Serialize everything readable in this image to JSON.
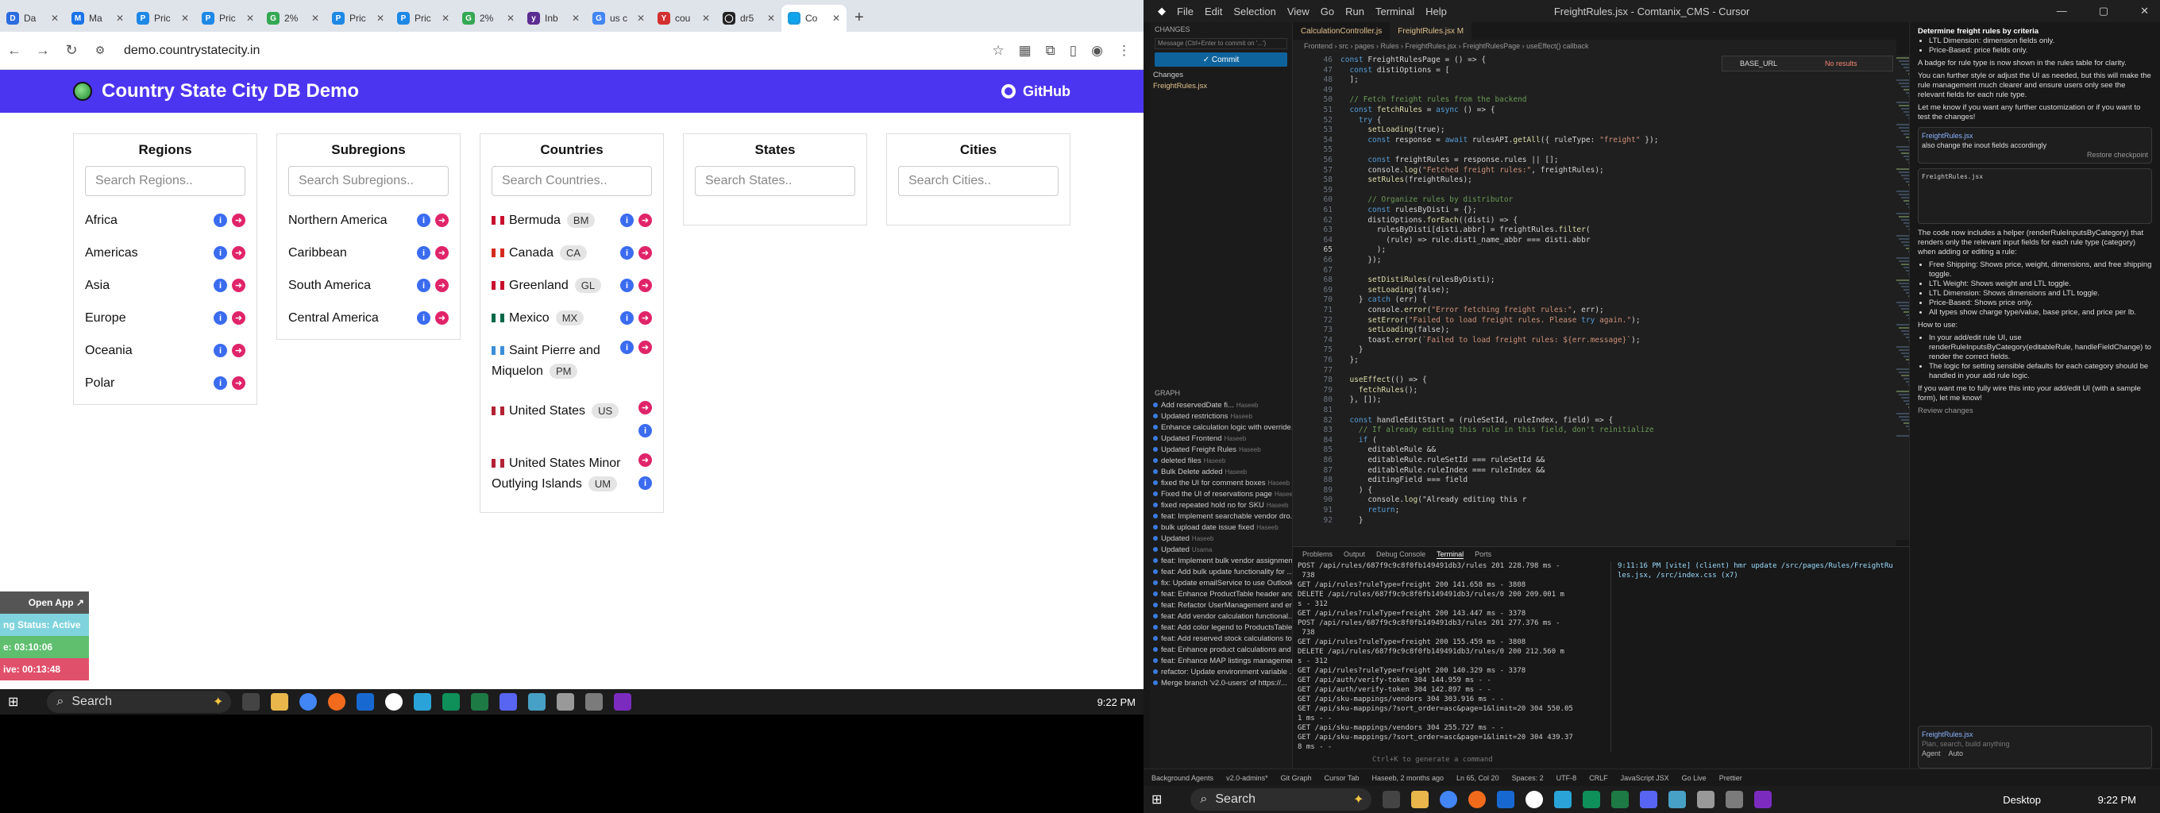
{
  "browser": {
    "tabs": [
      {
        "label": "Da",
        "color": "#2b6cdf",
        "glyph": "D"
      },
      {
        "label": "Ma",
        "color": "#1a73e8",
        "glyph": "M"
      },
      {
        "label": "Pric",
        "color": "#1e88e5",
        "glyph": "P"
      },
      {
        "label": "Pric",
        "color": "#1e88e5",
        "glyph": "P"
      },
      {
        "label": "2%",
        "color": "#34a853",
        "glyph": "G"
      },
      {
        "label": "Pric",
        "color": "#1e88e5",
        "glyph": "P"
      },
      {
        "label": "Pric",
        "color": "#1e88e5",
        "glyph": "P"
      },
      {
        "label": "2%",
        "color": "#34a853",
        "glyph": "G"
      },
      {
        "label": "Inb",
        "color": "#5b2d90",
        "glyph": "y"
      },
      {
        "label": "us c",
        "color": "#4285f4",
        "glyph": "G"
      },
      {
        "label": "cou",
        "color": "#d32f2f",
        "glyph": "Y"
      },
      {
        "label": "dr5",
        "color": "#222222",
        "glyph": "◯"
      },
      {
        "label": "Co",
        "color": "#1a9be0",
        "glyph": "🌐"
      }
    ],
    "url": "demo.countrystatecity.in"
  },
  "site": {
    "title": "Country State City DB Demo",
    "github": "GitHub",
    "colors": {
      "header": "#4c35f0",
      "info": "#3b6cf0",
      "action": "#e0246a"
    },
    "regions": {
      "title": "Regions",
      "placeholder": "Search Regions..",
      "items": [
        "Africa",
        "Americas",
        "Asia",
        "Europe",
        "Oceania",
        "Polar"
      ]
    },
    "subregions": {
      "title": "Subregions",
      "placeholder": "Search Subregions..",
      "items": [
        "Northern America",
        "Caribbean",
        "South America",
        "Central America"
      ]
    },
    "countries": {
      "title": "Countries",
      "placeholder": "Search Countries..",
      "items": [
        {
          "name": "Bermuda",
          "code": "BM"
        },
        {
          "name": "Canada",
          "code": "CA"
        },
        {
          "name": "Greenland",
          "code": "GL"
        },
        {
          "name": "Mexico",
          "code": "MX"
        },
        {
          "name": "Saint Pierre and Miquelon",
          "code": "PM"
        },
        {
          "name": "United States",
          "code": "US"
        },
        {
          "name": "United States Minor Outlying Islands",
          "code": "UM"
        }
      ]
    },
    "states": {
      "title": "States",
      "placeholder": "Search States.."
    },
    "cities": {
      "title": "Cities",
      "placeholder": "Search Cities.."
    }
  },
  "overlay": {
    "open_app": "Open App ↗",
    "status": "ng Status: Active",
    "timer1": "e: 03:10:06",
    "timer2": "ive: 00:13:48"
  },
  "left_taskbar": {
    "search": "Search",
    "clock": "9:22 PM"
  },
  "editor": {
    "title": "FreightRules.jsx - Comtanix_CMS - Cursor",
    "menu": [
      "File",
      "Edit",
      "Selection",
      "View",
      "Go",
      "Run",
      "Terminal",
      "Help"
    ],
    "tabs": [
      "CalculationController.js",
      "FreightRules.jsx M"
    ],
    "breadcrumb": "Frontend › src › pages › Rules › FreightRules.jsx › FreightRulesPage › useEffect() callback",
    "find": "BASE_URL",
    "find_result": "No results",
    "commit": "✓ Commit",
    "commit_placeholder": "Message (Ctrl+Enter to commit on '...')",
    "changes_label": "Changes",
    "changed_file": "FreightRules.jsx",
    "graph_label": "GRAPH",
    "git_log": [
      [
        "Add reservedDate fi...",
        "Haseeb"
      ],
      [
        "Updated restrictions",
        "Haseeb"
      ],
      [
        "Enhance calculation logic with override...",
        ""
      ],
      [
        "Updated Frontend",
        "Haseeb"
      ],
      [
        "Updated Freight Rules",
        "Haseeb"
      ],
      [
        "deleted files",
        "Haseeb"
      ],
      [
        "Bulk Delete added",
        "Haseeb"
      ],
      [
        "fixed the UI for comment boxes",
        "Haseeb"
      ],
      [
        "Fixed the UI of reservations page",
        "Haseeb"
      ],
      [
        "fixed repeated hold no for SKU",
        "Haseeb"
      ],
      [
        "feat: Implement searchable vendor dro...",
        ""
      ],
      [
        "bulk upload date issue fixed",
        "Haseeb"
      ],
      [
        "Updated",
        "Haseeb"
      ],
      [
        "Updated",
        "Usama"
      ],
      [
        "feat: Implement bulk vendor assignmen...",
        ""
      ],
      [
        "feat: Add bulk update functionality for ...",
        ""
      ],
      [
        "fix: Update emailService to use Outlook...",
        ""
      ],
      [
        "feat: Enhance ProductTable header and...",
        ""
      ],
      [
        "feat: Refactor UserManagement and en...",
        ""
      ],
      [
        "feat: Add vendor calculation functional...",
        ""
      ],
      [
        "feat: Add color legend to ProductsTable...",
        ""
      ],
      [
        "feat: Add reserved stock calculations to...",
        ""
      ],
      [
        "feat: Enhance product calculations and ...",
        ""
      ],
      [
        "feat: Enhance MAP listings managemen...",
        ""
      ],
      [
        "refactor: Update environment variable ...",
        ""
      ],
      [
        "Merge branch 'v2.0-users' of https://...",
        ""
      ]
    ],
    "code_start": 46,
    "code": [
      "const FreightRulesPage = () => {",
      "  const distiOptions = [",
      "  ];",
      "",
      "  // Fetch freight rules from the backend",
      "  const fetchRules = async () => {",
      "    try {",
      "      setLoading(true);",
      "      const response = await rulesAPI.getAll({ ruleType: \"freight\" });",
      "",
      "      const freightRules = response.rules || [];",
      "      console.log(\"Fetched freight rules:\", freightRules);",
      "      setRules(freightRules);",
      "",
      "      // Organize rules by distributor",
      "      const rulesByDisti = {};",
      "      distiOptions.forEach((disti) => {",
      "        rulesByDisti[disti.abbr] = freightRules.filter(",
      "          (rule) => rule.disti_name_abbr === disti.abbr",
      "        );",
      "      });",
      "",
      "      setDistiRules(rulesByDisti);",
      "      setLoading(false);",
      "    } catch (err) {",
      "      console.error(\"Error fetching freight rules:\", err);",
      "      setError(\"Failed to load freight rules. Please try again.\");",
      "      setLoading(false);",
      "      toast.error(`Failed to load freight rules: ${err.message}`);",
      "    }",
      "  };",
      "",
      "  useEffect(() => {",
      "    fetchRules();",
      "  }, []);",
      "",
      "  const handleEditStart = (ruleSetId, ruleIndex, field) => {",
      "    // If already editing this rule in this field, don't reinitialize",
      "    if (",
      "      editableRule &&",
      "      editableRule.ruleSetId === ruleSetId &&",
      "      editableRule.ruleIndex === ruleIndex &&",
      "      editingField === field",
      "    ) {",
      "      console.log(\"Already editing this r",
      "      return;",
      "    }"
    ],
    "term_tabs": [
      "Problems",
      "Output",
      "Debug Console",
      "Terminal",
      "Ports"
    ],
    "term_left": [
      "POST /api/rules/687f9c9c8f0fb149491db3/rules 201 228.798 ms -",
      " 738",
      "GET /api/rules?ruleType=freight 200 141.658 ms - 3808",
      "DELETE /api/rules/687f9c9c8f0fb149491db3/rules/0 200 209.001 m",
      "s - 312",
      "GET /api/rules?ruleType=freight 200 143.447 ms - 3378",
      "POST /api/rules/687f9c9c8f0fb149491db3/rules 201 277.376 ms -",
      " 738",
      "GET /api/rules?ruleType=freight 200 155.459 ms - 3808",
      "DELETE /api/rules/687f9c9c8f0fb149491db3/rules/0 200 212.560 m",
      "s - 312",
      "GET /api/rules?ruleType=freight 200 140.329 ms - 3378",
      "GET /api/auth/verify-token 304 144.959 ms - -",
      "GET /api/auth/verify-token 304 142.897 ms - -",
      "GET /api/sku-mappings/vendors 304 303.916 ms - -",
      "GET /api/sku-mappings/?sort_order=asc&page=1&limit=20 304 550.05",
      "1 ms - -",
      "GET /api/sku-mappings/vendors 304 255.727 ms - -",
      "GET /api/sku-mappings/?sort_order=asc&page=1&limit=20 304 439.37",
      "8 ms - -"
    ],
    "term_right": [
      "9:11:16 PM [vite] (client) hmr update /src/pages/Rules/FreightRu",
      "les.jsx, /src/index.css (x7)"
    ],
    "term_hint": "Ctrl+K to generate a command",
    "statusbar": [
      "Background Agents",
      "v2.0-admins*",
      "Git Graph",
      "Cursor Tab",
      "Haseeb, 2 months ago",
      "Ln 65, Col 20",
      "Spaces: 2",
      "UTF-8",
      "CRLF",
      "JavaScript JSX",
      "Go Live",
      "Prettier"
    ]
  },
  "chat": {
    "heading": "Determine freight rules by criteria",
    "bullets_top": [
      "LTL Dimension: dimension fields only.",
      "Price-Based: price fields only."
    ],
    "p1": "A badge for rule type is now shown in the rules table for clarity.",
    "p2": "You can further style or adjust the UI as needed, but this will make the rule management much clearer and ensure users only see the relevant fields for each rule type.",
    "p3": "Let me know if you want any further customization or if you want to test the changes!",
    "file": "FreightRules.jsx",
    "user_msg": "also change the inout fields accordingly",
    "restore": "Restore checkpoint",
    "p4": "The code now includes a helper (renderRuleInputsByCategory) that renders only the relevant input fields for each rule type (category) when adding or editing a rule:",
    "bullets_mid": [
      "Free Shipping: Shows price, weight, dimensions, and free shipping toggle.",
      "LTL Weight: Shows weight and LTL toggle.",
      "LTL Dimension: Shows dimensions and LTL toggle.",
      "Price-Based: Shows price only.",
      "All types show charge type/value, base price, and price per lb."
    ],
    "p5": "How to use:",
    "bullets_use": [
      "In your add/edit rule UI, use renderRuleInputsByCategory(editableRule, handleFieldChange) to render the correct fields.",
      "The logic for setting sensible defaults for each category should be handled in your add rule logic."
    ],
    "p6": "If you want me to fully wire this into your add/edit UI (with a sample form), let me know!",
    "review": "Review changes",
    "input_placeholder": "Plan, search, build anything",
    "agent": "Agent",
    "auto": "Auto"
  },
  "right_taskbar": {
    "search": "Search",
    "desktop": "Desktop",
    "clock": "9:22 PM"
  }
}
